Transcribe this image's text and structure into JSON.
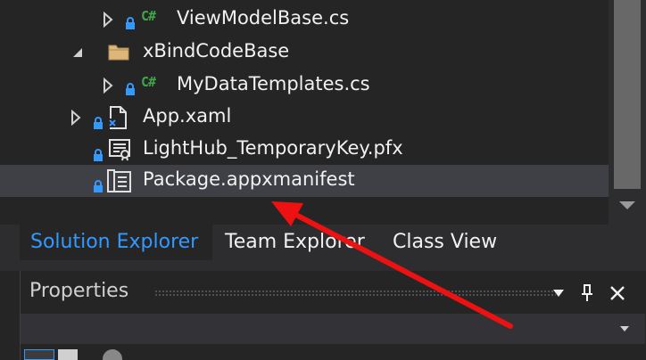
{
  "solution_tree": {
    "items": [
      {
        "label": "ViewModelBase.cs",
        "icon": "csharp-file-icon",
        "lang_badge": "C#",
        "expander": "collapsed",
        "locked": true
      },
      {
        "label": "xBindCodeBase",
        "icon": "folder-icon",
        "expander": "expanded",
        "locked": false
      },
      {
        "label": "MyDataTemplates.cs",
        "icon": "csharp-file-icon",
        "lang_badge": "C#",
        "expander": "collapsed",
        "locked": true
      },
      {
        "label": "App.xaml",
        "icon": "xaml-file-icon",
        "expander": "collapsed",
        "locked": true
      },
      {
        "label": "LightHub_TemporaryKey.pfx",
        "icon": "certificate-file-icon",
        "expander": "none",
        "locked": true
      },
      {
        "label": "Package.appxmanifest",
        "icon": "manifest-file-icon",
        "expander": "none",
        "locked": true,
        "selected": true
      }
    ]
  },
  "tabs": [
    {
      "label": "Solution Explorer",
      "active": true
    },
    {
      "label": "Team Explorer",
      "active": false
    },
    {
      "label": "Class View",
      "active": false
    }
  ],
  "properties_panel": {
    "title": "Properties",
    "controls": [
      "dropdown-menu-icon",
      "pin-icon",
      "close-icon"
    ]
  },
  "colors": {
    "background": "#252526",
    "selection": "#3f3f46",
    "accent": "#3399ff",
    "csharp_badge": "#3ea649",
    "lock": "#3399ff",
    "annotation_arrow": "#ee1111"
  }
}
